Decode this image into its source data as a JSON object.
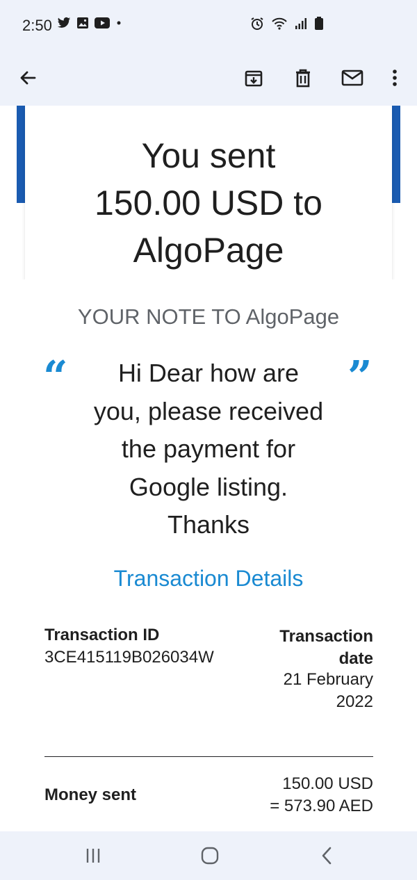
{
  "status_bar": {
    "time": "2:50",
    "left_icons": [
      "twitter-icon",
      "gallery-icon",
      "youtube-icon",
      "dot-icon"
    ],
    "right_icons": [
      "alarm-icon",
      "wifi-icon",
      "signal-icon",
      "battery-icon"
    ]
  },
  "app_bar": {
    "actions": [
      "back-arrow-icon",
      "archive-icon",
      "delete-icon",
      "mark-unread-icon",
      "more-vert-icon"
    ]
  },
  "email": {
    "headline_lines": [
      "You sent",
      "150.00 USD to",
      "AlgoPage"
    ],
    "note_title": "YOUR NOTE TO AlgoPage",
    "note_lines": [
      "Hi Dear how are",
      "you, please received",
      "the payment for",
      "Google listing.",
      "Thanks"
    ],
    "quote_open": "“",
    "quote_close": "”",
    "transaction_link": "Transaction Details",
    "transaction_id_label": "Transaction ID",
    "transaction_id": "3CE415119B026034W",
    "transaction_date_label_lines": [
      "Transaction",
      "date"
    ],
    "transaction_date_lines": [
      "21 February",
      "2022"
    ],
    "money_sent_label": "Money sent",
    "money_sent_lines": [
      "150.00 USD",
      "= 573.90 AED"
    ]
  },
  "colors": {
    "bar_background": "#eef2fa",
    "brand_blue": "#1a5bb1",
    "link_blue": "#1a8ad2"
  },
  "nav_bar": {
    "buttons": [
      "recents-icon",
      "home-icon",
      "back-icon"
    ]
  }
}
